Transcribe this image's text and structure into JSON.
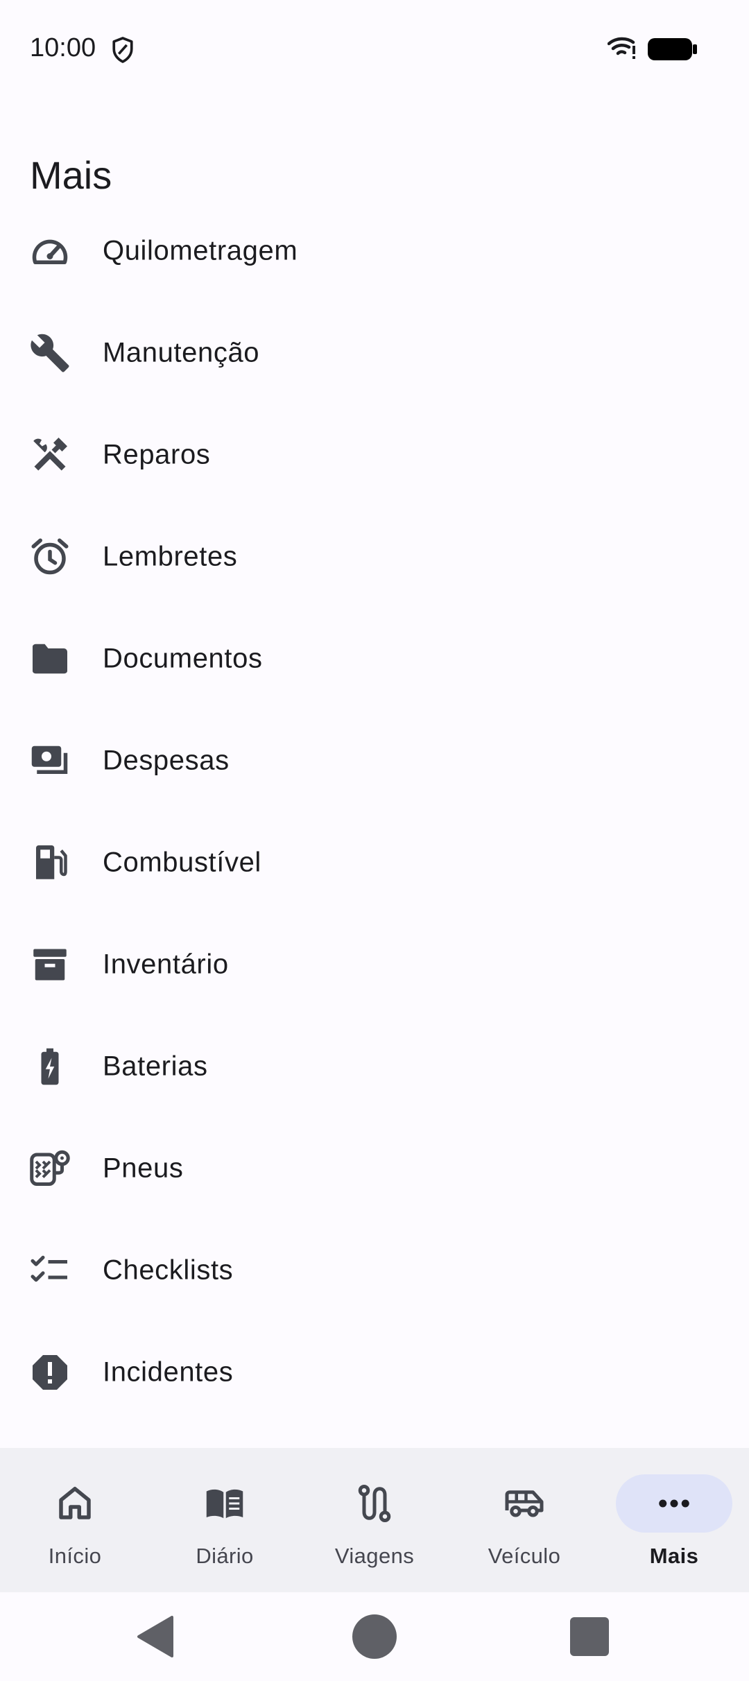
{
  "status_bar": {
    "time": "10:00",
    "icons": [
      "shield-icon",
      "wifi-icon",
      "battery-icon"
    ]
  },
  "page": {
    "title": "Mais"
  },
  "menu": {
    "items": [
      {
        "label": "Quilometragem",
        "icon": "speedometer-icon"
      },
      {
        "label": "Manutenção",
        "icon": "wrench-icon"
      },
      {
        "label": "Reparos",
        "icon": "hammer-wrench-icon"
      },
      {
        "label": "Lembretes",
        "icon": "alarm-icon"
      },
      {
        "label": "Documentos",
        "icon": "folder-icon"
      },
      {
        "label": "Despesas",
        "icon": "payments-icon"
      },
      {
        "label": "Combustível",
        "icon": "fuel-pump-icon"
      },
      {
        "label": "Inventário",
        "icon": "archive-box-icon"
      },
      {
        "label": "Baterias",
        "icon": "battery-charging-icon"
      },
      {
        "label": "Pneus",
        "icon": "tire-pressure-icon"
      },
      {
        "label": "Checklists",
        "icon": "checklist-icon"
      },
      {
        "label": "Incidentes",
        "icon": "alert-octagon-icon"
      }
    ]
  },
  "bottom_nav": {
    "items": [
      {
        "label": "Início",
        "icon": "home-icon"
      },
      {
        "label": "Diário",
        "icon": "book-icon"
      },
      {
        "label": "Viagens",
        "icon": "route-icon"
      },
      {
        "label": "Veículo",
        "icon": "van-icon"
      },
      {
        "label": "Mais",
        "icon": "more-horizontal-icon"
      }
    ],
    "active": "Mais"
  },
  "system_nav": {
    "buttons": [
      "back-icon",
      "home-circle-icon",
      "recents-icon"
    ]
  },
  "colors": {
    "background": "#fdfbff",
    "icon": "#44474f",
    "nav_background": "#f0f0f4",
    "active_pill": "#dfe3f8"
  }
}
